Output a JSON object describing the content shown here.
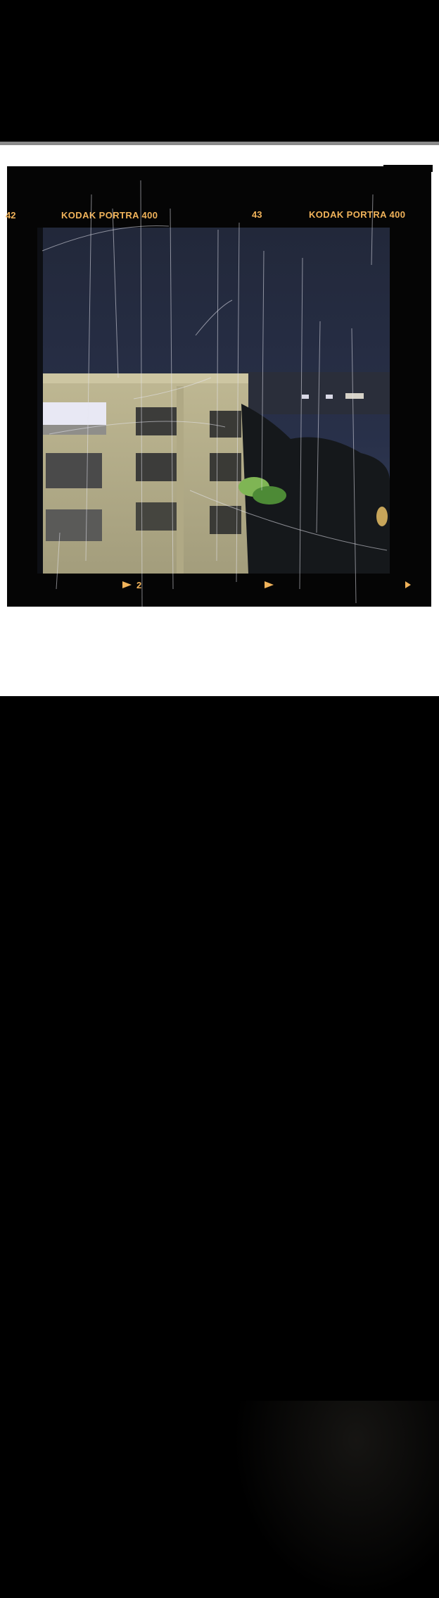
{
  "film": {
    "stock_label_left": "KODAK  PORTRA 400",
    "stock_label_right": "KODAK  PORTRA 400",
    "frame_number_prev": "42",
    "frame_number_current": "43",
    "bottom_frame_number": "2",
    "marking_color": "#f1b35a"
  },
  "photo": {
    "subject": "night-cityscape-apartment-building",
    "sky_color": "#242a3d",
    "building_color": "#cfc8a3"
  },
  "layout_colors": {
    "background": "#000000",
    "mat": "#ffffff",
    "separator": "#8a8a8a"
  }
}
